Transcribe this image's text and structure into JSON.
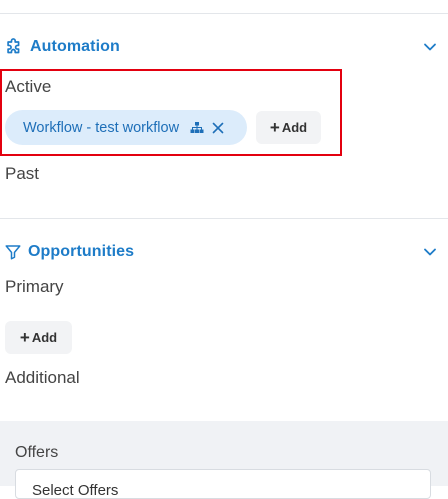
{
  "automation": {
    "title": "Automation",
    "icon": "puzzle-icon",
    "active_label": "Active",
    "active_workflow": {
      "label": "Workflow - test workflow",
      "icon": "sitemap-icon"
    },
    "add_label": "Add",
    "past_label": "Past"
  },
  "opportunities": {
    "title": "Opportunities",
    "icon": "filter-icon",
    "primary_label": "Primary",
    "add_label": "Add",
    "additional_label": "Additional"
  },
  "offers": {
    "label": "Offers",
    "select_text": "Select Offers"
  },
  "colors": {
    "accent": "#1e7cc8",
    "chip_bg": "#dcecfb",
    "highlight": "#e3000f"
  }
}
